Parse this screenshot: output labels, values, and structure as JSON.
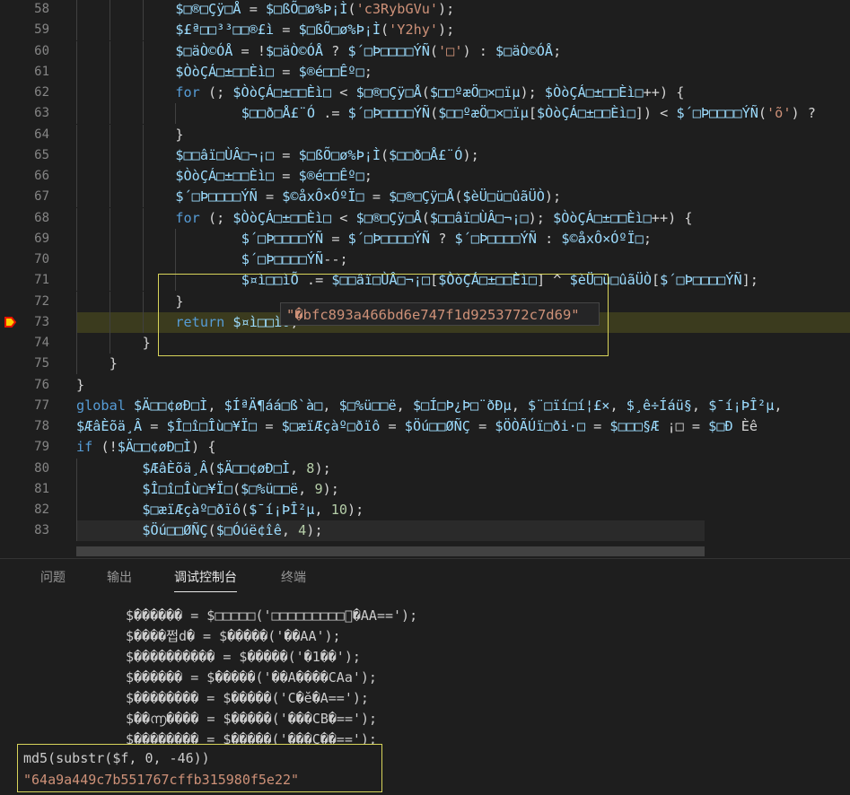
{
  "colors": {
    "editor_bg": "#1e1e1e",
    "keyword": "#569cd6",
    "variable": "#9cdcfe",
    "string": "#ce9178",
    "function": "#dcdcaa",
    "number": "#b5cea8",
    "annotation_border": "#d8d45a",
    "breakpoint": "#e51400",
    "current_line": "#3b3b1e"
  },
  "editor": {
    "lines": [
      {
        "n": "58",
        "text": "$□®□Çÿ□Å = $□ßÕ□ø%Þ¡Ì('c3RybGVu');"
      },
      {
        "n": "59",
        "text": "$£ª□□³³□□®£ì = $□ßÕ□ø%Þ¡Ì('Y2hy');"
      },
      {
        "n": "60",
        "text": "$□äÒ©ÓÅ = !$□äÒ©ÓÅ ? $´□Þ□□□□ÝÑ('□') : $□äÒ©ÓÅ;"
      },
      {
        "n": "61",
        "text": "$ÒòÇÁ□±□□Èì□ = $®é□□Êº□;"
      },
      {
        "n": "62",
        "text": "for (; $ÒòÇÁ□±□□Èì□ < $□®□Çÿ□Å($□□ºæÖ□×□ïµ); $ÒòÇÁ□±□□Èì□++) {"
      },
      {
        "n": "63",
        "text": "    $□□ð□Å£¨Ó .= $´□Þ□□□□ÝÑ($□□ºæÖ□×□ïµ[$ÒòÇÁ□±□□Èì□]) < $´□Þ□□□□ÝÑ('õ') ?"
      },
      {
        "n": "64",
        "text": "}"
      },
      {
        "n": "65",
        "text": "$□□âï□ÙÂ□¬¡□ = $□ßÕ□ø%Þ¡Ì($□□ð□Å£¨Ó);"
      },
      {
        "n": "66",
        "text": "$ÒòÇÁ□±□□Èì□ = $®é□□Êº□;"
      },
      {
        "n": "67",
        "text": "$´□Þ□□□□ÝÑ = $©åxÔ×ÓºÏ□ = $□®□Çÿ□Å($èÜ□ü□ûãÜÒ);"
      },
      {
        "n": "68",
        "text": "for (; $ÒòÇÁ□±□□Èì□ < $□®□Çÿ□Å($□□âï□ÙÂ□¬¡□); $ÒòÇÁ□±□□Èì□++) {"
      },
      {
        "n": "69",
        "text": "    $´□Þ□□□□ÝÑ = $´□Þ□□□□ÝÑ ? $´□Þ□□□□ÝÑ : $©åxÔ×ÓºÏ□;"
      },
      {
        "n": "70",
        "text": "    $´□Þ□□□□ÝÑ--;"
      },
      {
        "n": "71",
        "text": "    $¤ì□□ìÕ .= $□□âï□ÙÂ□¬¡□[$ÒòÇÁ□±□□Èì□] ^ $èÜ□ü□ûãÜÒ[$´□Þ□□□□ÝÑ];"
      },
      {
        "n": "72",
        "text": "}"
      },
      {
        "n": "73",
        "text": "return $¤ì□□ìÕ;"
      },
      {
        "n": "74",
        "text": "}"
      },
      {
        "n": "75",
        "text": "}"
      },
      {
        "n": "76",
        "text": "}"
      },
      {
        "n": "77",
        "text": "global $Ä□□¢øÐ□Ì, $ÍªÄ¶áá□ß`à□, $□%ü□□ë, $□Í□Þ¿Þ□¨ðÐµ, $¨□ïí□í¦£×, $¸ê÷Íáü§, $¯í¡ÞÎ²µ,"
      },
      {
        "n": "78",
        "text": "$ÆâÈõä¸Â = $Î□î□Îù□¥Ï□ = $□æïÆçàº□ðïô = $Öú□□ØÑÇ = $ÖÒÃÚï□ði·□ = $□□□§Æ ¡□ = $□Ð Èê"
      },
      {
        "n": "79",
        "text": "if (!$Ä□□¢øÐ□Ì) {"
      },
      {
        "n": "80",
        "text": "    $ÆâÈõä¸Â($Ä□□¢øÐ□Ì, 8);"
      },
      {
        "n": "81",
        "text": "    $Î□î□Îù□¥Ï□($□%ü□□ë, 9);"
      },
      {
        "n": "82",
        "text": "    $□æïÆçàº□ðïô($¯í¡ÞÎ²µ, 10);"
      },
      {
        "n": "83",
        "text": "    $Öú□□ØÑÇ($□Óúë¢îê, 4);"
      }
    ],
    "hover_value": "\"�bfc893a466bd6e747f1d9253772c7d69\""
  },
  "panel": {
    "tabs": [
      "问题",
      "输出",
      "调试控制台",
      "终端"
    ],
    "active_tab": "调试控制台"
  },
  "console": {
    "lines": [
      "$������ = $□□□□□('□□□□□□□□□ౖ�AA==');",
      "$����쩝d� = $�����('��AA');",
      "$���������� = $�����('�1��');",
      "$������ = $�����('��A����CAa');",
      "$�������� = $�����('C�ӗ�A==');",
      "$��൬���� = $�����('���CB�==');",
      "$�������� = $�����('���C��==');"
    ],
    "expression": "md5(substr($f, 0, -46))",
    "result": "\"64a9a449c7b551767cffb315980f5e22\""
  }
}
